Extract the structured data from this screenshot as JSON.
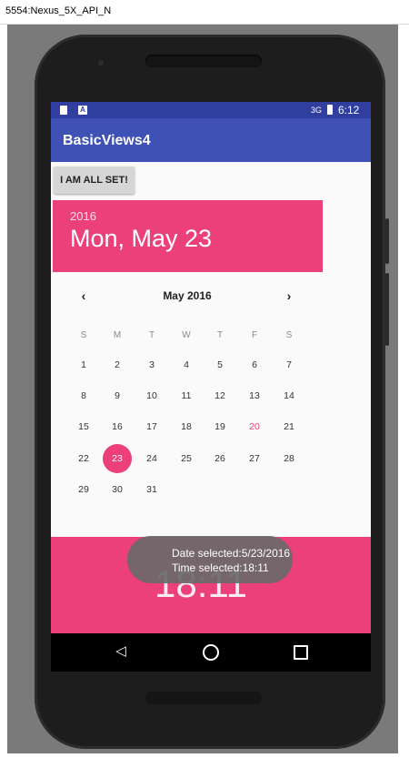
{
  "window": {
    "title": "5554:Nexus_5X_API_N"
  },
  "status_bar": {
    "time": "6:12",
    "network": "3G"
  },
  "app_bar": {
    "title": "BasicViews4"
  },
  "button": {
    "label": "I AM ALL SET!"
  },
  "date_header": {
    "year": "2016",
    "date": "Mon, May 23"
  },
  "calendar": {
    "month_label": "May 2016",
    "prev_icon": "chevron-left-icon",
    "next_icon": "chevron-right-icon",
    "weekdays": [
      "S",
      "M",
      "T",
      "W",
      "T",
      "F",
      "S"
    ],
    "weeks": [
      [
        "1",
        "2",
        "3",
        "4",
        "5",
        "6",
        "7"
      ],
      [
        "8",
        "9",
        "10",
        "11",
        "12",
        "13",
        "14"
      ],
      [
        "15",
        "16",
        "17",
        "18",
        "19",
        "20",
        "21"
      ],
      [
        "22",
        "23",
        "24",
        "25",
        "26",
        "27",
        "28"
      ],
      [
        "29",
        "30",
        "31"
      ]
    ],
    "selected_day": "23",
    "today": "20"
  },
  "time_header": {
    "time": "18:11"
  },
  "toast": {
    "line1": "Date selected:5/23/2016",
    "line2": "Time selected:18:11"
  },
  "colors": {
    "accent": "#EC407A",
    "primary": "#3F51B5",
    "primary_dark": "#303F9F"
  }
}
